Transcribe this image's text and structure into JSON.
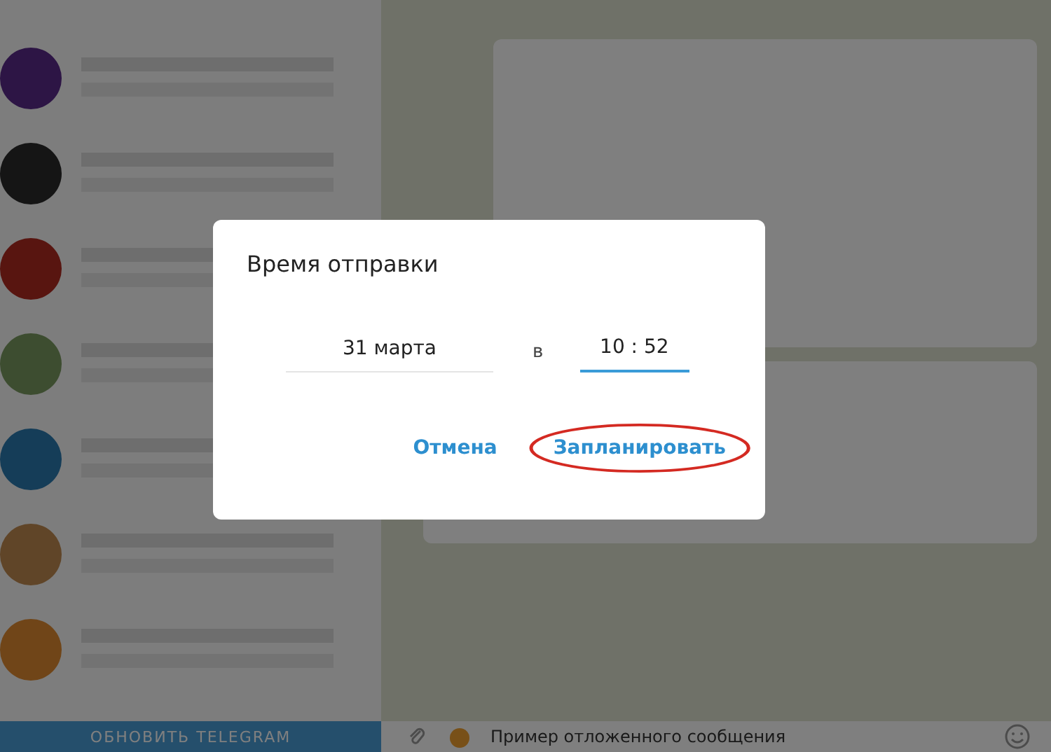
{
  "chats": [
    {
      "color": "#2d1545"
    },
    {
      "color": "#151515"
    },
    {
      "color": "#581510"
    },
    {
      "color": "#3d4d30"
    },
    {
      "color": "#153d58"
    },
    {
      "color": "#604528"
    },
    {
      "color": "#704518"
    }
  ],
  "update_button": {
    "label": "ОБНОВИТЬ TELEGRAM"
  },
  "composer": {
    "placeholder": "Пример отложенного сообщения"
  },
  "dialog": {
    "title": "Время отправки",
    "date": "31 марта",
    "separator": "в",
    "time": "10 : 52",
    "time_focused": true,
    "buttons": [
      {
        "label": "Отмена",
        "highlighted": false
      },
      {
        "label": "Запланировать",
        "highlighted": true
      }
    ]
  }
}
